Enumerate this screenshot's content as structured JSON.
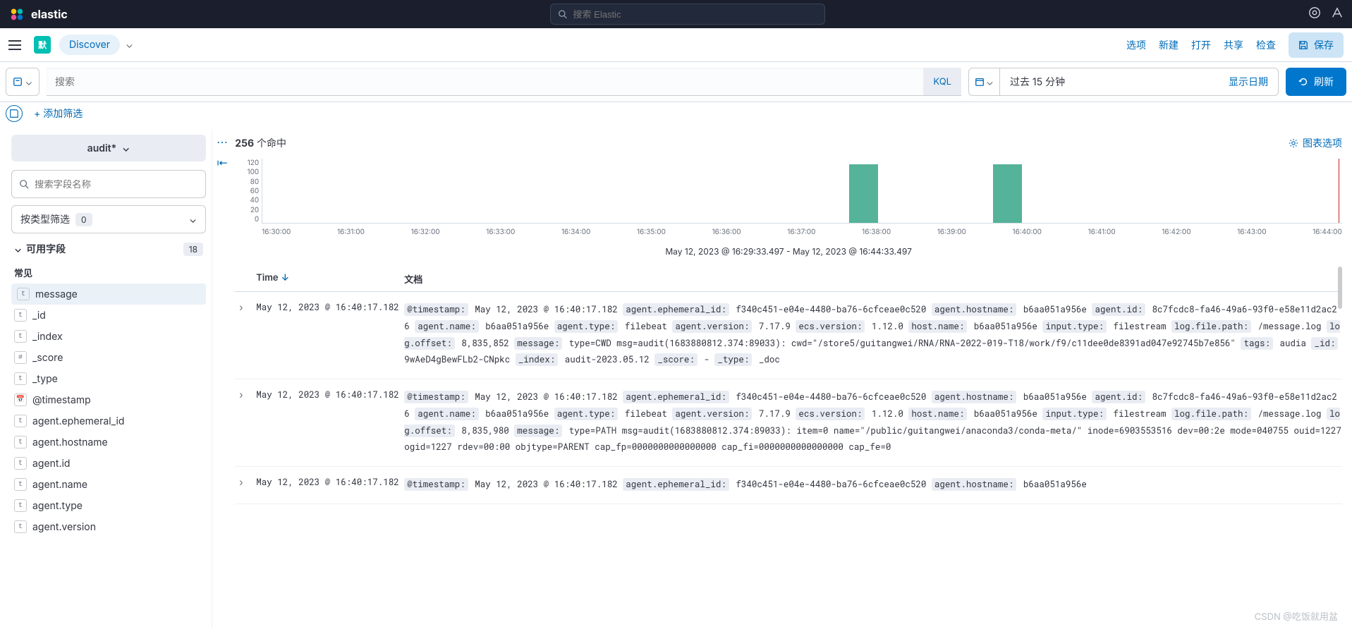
{
  "header": {
    "brand": "elastic",
    "search_placeholder": "搜索 Elastic"
  },
  "appbar": {
    "badge_default": "默",
    "discover": "Discover",
    "links": {
      "options": "选项",
      "new": "新建",
      "open": "打开",
      "share": "共享",
      "inspect": "检查"
    },
    "save": "保存"
  },
  "querybar": {
    "search_placeholder": "搜索",
    "kql": "KQL",
    "date_value": "过去 15 分钟",
    "show_date": "显示日期",
    "refresh": "刷新"
  },
  "filterbar": {
    "add": "+ 添加筛选"
  },
  "sidebar": {
    "index_pattern": "audit*",
    "field_search_placeholder": "搜索字段名称",
    "type_filter": "按类型筛选",
    "type_count": "0",
    "available": "可用字段",
    "available_count": "18",
    "common": "常见",
    "fields": [
      {
        "t": "t",
        "n": "message",
        "hl": true
      },
      {
        "t": "t",
        "n": "_id"
      },
      {
        "t": "t",
        "n": "_index"
      },
      {
        "t": "#",
        "n": "_score"
      },
      {
        "t": "t",
        "n": "_type"
      },
      {
        "t": "d",
        "n": "@timestamp"
      },
      {
        "t": "t",
        "n": "agent.ephemeral_id"
      },
      {
        "t": "t",
        "n": "agent.hostname"
      },
      {
        "t": "t",
        "n": "agent.id"
      },
      {
        "t": "t",
        "n": "agent.name"
      },
      {
        "t": "t",
        "n": "agent.type"
      },
      {
        "t": "t",
        "n": "agent.version"
      }
    ]
  },
  "results": {
    "hit_count": "256",
    "hit_label": "个命中",
    "chart_options": "图表选项",
    "caption": "May 12, 2023 @ 16:29:33.497 - May 12, 2023 @ 16:44:33.497",
    "col_time": "Time",
    "col_doc": "文档"
  },
  "chart_data": {
    "type": "bar",
    "categories": [
      "16:30:00",
      "16:31:00",
      "16:32:00",
      "16:33:00",
      "16:34:00",
      "16:35:00",
      "16:36:00",
      "16:37:00",
      "16:38:00",
      "16:39:00",
      "16:40:00",
      "16:41:00",
      "16:42:00",
      "16:43:00",
      "16:44:00"
    ],
    "values": [
      0,
      0,
      0,
      0,
      0,
      0,
      0,
      0,
      128,
      0,
      128,
      0,
      0,
      0,
      0
    ],
    "ylim": [
      0,
      140
    ],
    "yticks": [
      0,
      20,
      40,
      60,
      80,
      100,
      120
    ],
    "xlabel": "",
    "ylabel": "",
    "title": "May 12, 2023 @ 16:29:33.497 - May 12, 2023 @ 16:44:33.497"
  },
  "docs": [
    {
      "time": "May 12, 2023 @ 16:40:17.182",
      "kv": [
        [
          "@timestamp:",
          "May 12, 2023 @ 16:40:17.182"
        ],
        [
          "agent.ephemeral_id:",
          "f340c451-e04e-4480-ba76-6cfceae0c520"
        ],
        [
          "agent.hostname:",
          "b6aa051a956e"
        ],
        [
          "agent.id:",
          "8c7fcdc8-fa46-49a6-93f0-e58e11d2ac26"
        ],
        [
          "agent.name:",
          "b6aa051a956e"
        ],
        [
          "agent.type:",
          "filebeat"
        ],
        [
          "agent.version:",
          "7.17.9"
        ],
        [
          "ecs.version:",
          "1.12.0"
        ],
        [
          "host.name:",
          "b6aa051a956e"
        ],
        [
          "input.type:",
          "filestream"
        ],
        [
          "log.file.path:",
          "/message.log"
        ],
        [
          "log.offset:",
          "8,835,852"
        ],
        [
          "message:",
          "type=CWD msg=audit(1683880812.374:89033): cwd=\"/store5/guitangwei/RNA/RNA-2022-019-T18/work/f9/c11dee0de8391ad047e92745b7e856\""
        ],
        [
          "tags:",
          "audia"
        ],
        [
          "_id:",
          "9wAeD4gBewFLb2-CNpkc"
        ],
        [
          "_index:",
          "audit-2023.05.12"
        ],
        [
          "_score:",
          "-"
        ],
        [
          "_type:",
          "_doc"
        ]
      ]
    },
    {
      "time": "May 12, 2023 @ 16:40:17.182",
      "kv": [
        [
          "@timestamp:",
          "May 12, 2023 @ 16:40:17.182"
        ],
        [
          "agent.ephemeral_id:",
          "f340c451-e04e-4480-ba76-6cfceae0c520"
        ],
        [
          "agent.hostname:",
          "b6aa051a956e"
        ],
        [
          "agent.id:",
          "8c7fcdc8-fa46-49a6-93f0-e58e11d2ac26"
        ],
        [
          "agent.name:",
          "b6aa051a956e"
        ],
        [
          "agent.type:",
          "filebeat"
        ],
        [
          "agent.version:",
          "7.17.9"
        ],
        [
          "ecs.version:",
          "1.12.0"
        ],
        [
          "host.name:",
          "b6aa051a956e"
        ],
        [
          "input.type:",
          "filestream"
        ],
        [
          "log.file.path:",
          "/message.log"
        ],
        [
          "log.offset:",
          "8,835,980"
        ],
        [
          "message:",
          "type=PATH msg=audit(1683880812.374:89033): item=0 name=\"/public/guitangwei/anaconda3/conda-meta/\" inode=6903553516 dev=00:2e mode=040755 ouid=1227 ogid=1227 rdev=00:00 objtype=PARENT cap_fp=0000000000000000 cap_fi=0000000000000000 cap_fe=0"
        ]
      ]
    },
    {
      "time": "May 12, 2023 @ 16:40:17.182",
      "kv": [
        [
          "@timestamp:",
          "May 12, 2023 @ 16:40:17.182"
        ],
        [
          "agent.ephemeral_id:",
          "f340c451-e04e-4480-ba76-6cfceae0c520"
        ],
        [
          "agent.hostname:",
          "b6aa051a956e"
        ]
      ]
    }
  ],
  "watermark": "CSDN @吃饭就用盆"
}
